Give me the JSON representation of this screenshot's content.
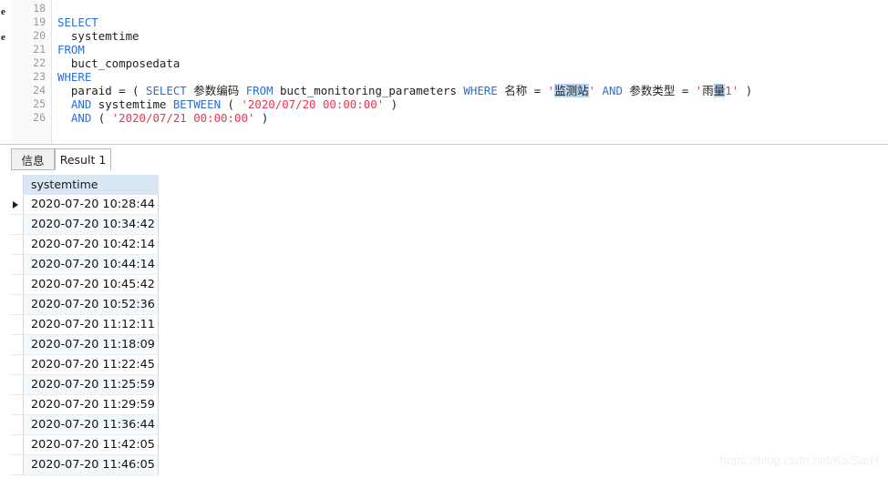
{
  "editor": {
    "ghost_margin_chars": [
      "e",
      "e"
    ],
    "line_numbers": [
      "18",
      "19",
      "20",
      "21",
      "22",
      "23",
      "24",
      "25",
      "26"
    ],
    "lines": [
      {
        "num": "18",
        "segments": []
      },
      {
        "num": "19",
        "segments": [
          {
            "t": "SELECT",
            "c": "kw"
          }
        ]
      },
      {
        "num": "20",
        "segments": [
          {
            "t": "  systemtime",
            "c": "plain"
          }
        ]
      },
      {
        "num": "21",
        "segments": [
          {
            "t": "FROM",
            "c": "kw"
          }
        ]
      },
      {
        "num": "22",
        "segments": [
          {
            "t": "  buct_composedata",
            "c": "plain"
          }
        ]
      },
      {
        "num": "23",
        "segments": [
          {
            "t": "WHERE",
            "c": "kw"
          }
        ]
      },
      {
        "num": "24",
        "segments": [
          {
            "t": "  paraid = ( ",
            "c": "plain"
          },
          {
            "t": "SELECT",
            "c": "kw"
          },
          {
            "t": " ",
            "c": "plain"
          },
          {
            "t": "参数编码",
            "c": "cn"
          },
          {
            "t": " ",
            "c": "plain"
          },
          {
            "t": "FROM",
            "c": "kw"
          },
          {
            "t": " buct_monitoring_parameters ",
            "c": "plain"
          },
          {
            "t": "WHERE",
            "c": "kw"
          },
          {
            "t": " ",
            "c": "plain"
          },
          {
            "t": "名称",
            "c": "cn"
          },
          {
            "t": " = ",
            "c": "plain"
          },
          {
            "t": "'",
            "c": "str"
          },
          {
            "t": "CARET",
            "c": "caret"
          },
          {
            "t": "监测站",
            "c": "cn sel"
          },
          {
            "t": "'",
            "c": "str"
          },
          {
            "t": " ",
            "c": "plain"
          },
          {
            "t": "AND",
            "c": "kw"
          },
          {
            "t": " ",
            "c": "plain"
          },
          {
            "t": "参数类型",
            "c": "cn"
          },
          {
            "t": " = ",
            "c": "plain"
          },
          {
            "t": "'",
            "c": "str"
          },
          {
            "t": "雨",
            "c": "cn str"
          },
          {
            "t": "量",
            "c": "cn str sel"
          },
          {
            "t": "1",
            "c": "str"
          },
          {
            "t": "'",
            "c": "str"
          },
          {
            "t": " )",
            "c": "plain"
          }
        ]
      },
      {
        "num": "25",
        "segments": [
          {
            "t": "  ",
            "c": "plain"
          },
          {
            "t": "AND",
            "c": "kw"
          },
          {
            "t": " systemtime ",
            "c": "plain"
          },
          {
            "t": "BETWEEN",
            "c": "kw"
          },
          {
            "t": " ( ",
            "c": "plain"
          },
          {
            "t": "'2020/07/20 00:00:00'",
            "c": "str"
          },
          {
            "t": " )",
            "c": "plain"
          }
        ]
      },
      {
        "num": "26",
        "segments": [
          {
            "t": "  ",
            "c": "plain"
          },
          {
            "t": "AND",
            "c": "kw"
          },
          {
            "t": " ( ",
            "c": "plain"
          },
          {
            "t": "'2020/07/21 00:00:00'",
            "c": "str"
          },
          {
            "t": " )",
            "c": "plain"
          }
        ]
      }
    ],
    "colors": {
      "keyword": "#2a6fd6",
      "string": "#e8364f",
      "text": "#222222",
      "selection": "#b9d4f2",
      "line_number": "#9a9a9a",
      "gutter_bg": "#fafafa"
    }
  },
  "tabs": [
    {
      "label": "信息",
      "active": false
    },
    {
      "label": "Result 1",
      "active": true
    }
  ],
  "grid": {
    "columns": [
      "systemtime"
    ],
    "header_bg": "#d9e7f5",
    "alt_row_bg": "#f4f9fd",
    "current_row_index": 0,
    "rows": [
      [
        "2020-07-20 10:28:44"
      ],
      [
        "2020-07-20 10:34:42"
      ],
      [
        "2020-07-20 10:42:14"
      ],
      [
        "2020-07-20 10:44:14"
      ],
      [
        "2020-07-20 10:45:42"
      ],
      [
        "2020-07-20 10:52:36"
      ],
      [
        "2020-07-20 11:12:11"
      ],
      [
        "2020-07-20 11:18:09"
      ],
      [
        "2020-07-20 11:22:45"
      ],
      [
        "2020-07-20 11:25:59"
      ],
      [
        "2020-07-20 11:29:59"
      ],
      [
        "2020-07-20 11:36:44"
      ],
      [
        "2020-07-20 11:42:05"
      ],
      [
        "2020-07-20 11:46:05"
      ]
    ]
  },
  "watermark": {
    "text": "https://blog.csdn.net/KaiSarH"
  }
}
